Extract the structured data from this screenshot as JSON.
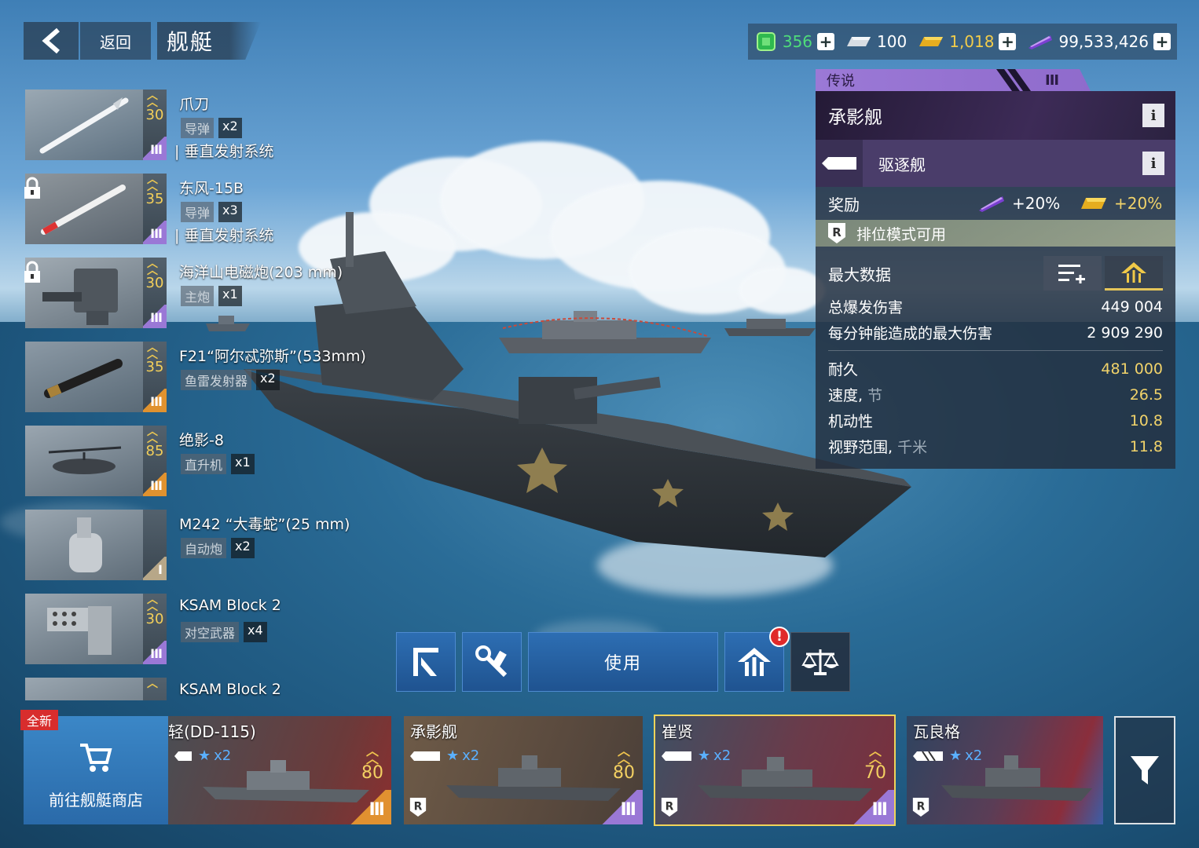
{
  "header": {
    "back_label": "返回",
    "title": "舰艇"
  },
  "currencies": [
    {
      "name": "gem-icon",
      "value": "356",
      "color": "#4fdc7a"
    },
    {
      "name": "silver-bar-icon",
      "value": "100",
      "color": "#e8edf2"
    },
    {
      "name": "gold-bar-icon",
      "value": "1,018",
      "color": "#f2cc4a"
    },
    {
      "name": "purple-credit-icon",
      "value": "99,533,426",
      "color": "#e8edf2"
    }
  ],
  "weapons": [
    {
      "name": "爪刀",
      "level": "30",
      "type": "导弹",
      "count": "x2",
      "system": "| 垂直发射系统",
      "tier": "III",
      "locked": false
    },
    {
      "name": "东风-15B",
      "level": "35",
      "type": "导弹",
      "count": "x3",
      "system": "| 垂直发射系统",
      "tier": "III",
      "locked": true
    },
    {
      "name": "海洋山电磁炮(203 mm)",
      "level": "30",
      "type": "主炮",
      "count": "x1",
      "system": "",
      "tier": "III",
      "locked": true
    },
    {
      "name": "F21“阿尔忒弥斯”(533mm)",
      "level": "35",
      "type": "鱼雷发射器",
      "count": "x2",
      "system": "",
      "tier": "III",
      "locked": false
    },
    {
      "name": "绝影-8",
      "level": "85",
      "type": "直升机",
      "count": "x1",
      "system": "",
      "tier": "III",
      "locked": false
    },
    {
      "name": "M242 “大毒蛇”(25 mm)",
      "level": "",
      "type": "自动炮",
      "count": "x2",
      "system": "",
      "tier": "I",
      "locked": false
    },
    {
      "name": "KSAM Block 2",
      "level": "30",
      "type": "对空武器",
      "count": "x4",
      "system": "",
      "tier": "III",
      "locked": false
    },
    {
      "name": "KSAM Block 2",
      "level": "",
      "type": "",
      "count": "",
      "system": "",
      "tier": "",
      "locked": false
    }
  ],
  "panel": {
    "rarity": "传说",
    "rarity_tier": "III",
    "ship_name": "承影舰",
    "ship_class": "驱逐舰",
    "reward_label": "奖励",
    "reward_credit": "+20%",
    "reward_gold": "+20%",
    "ranked": "排位模式可用",
    "stats_title": "最大数据",
    "stats_a": [
      {
        "label": "总爆发伤害",
        "unit": "",
        "value": "449 004"
      },
      {
        "label": "每分钟能造成的最大伤害",
        "unit": "",
        "value": "2 909 290"
      }
    ],
    "stats_b": [
      {
        "label": "耐久",
        "unit": "",
        "value": "481 000"
      },
      {
        "label": "速度,",
        "unit": " 节",
        "value": "26.5"
      },
      {
        "label": "机动性",
        "unit": "",
        "value": "10.8"
      },
      {
        "label": "视野范围,",
        "unit": " 千米",
        "value": "11.8"
      }
    ]
  },
  "actions": {
    "use_label": "使用",
    "upgrade_badge": "!"
  },
  "shop": {
    "new_tag": "全新",
    "label": "前往舰艇商店"
  },
  "ships": [
    {
      "name": "轻(DD-115)",
      "stars": "x2",
      "level": "80",
      "tier": "III",
      "tier_color": "orange"
    },
    {
      "name": "承影舰",
      "stars": "x2",
      "level": "80",
      "tier": "III",
      "tier_color": "purple"
    },
    {
      "name": "崔贤",
      "stars": "x2",
      "level": "70",
      "tier": "III",
      "tier_color": "purple"
    },
    {
      "name": "瓦良格",
      "stars": "x2",
      "level": "",
      "tier": "",
      "tier_color": ""
    }
  ]
}
